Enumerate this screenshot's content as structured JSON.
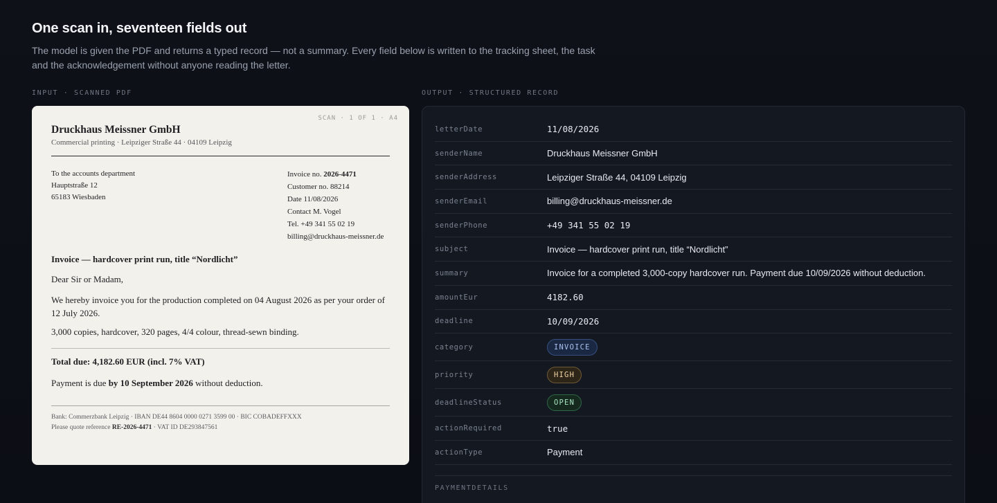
{
  "header": {
    "title": "One scan in, seventeen fields out",
    "intro": "The model is given the PDF and returns a typed record — not a summary. Every field below is written to the tracking sheet, the task and the acknowledgement without anyone reading the letter."
  },
  "input": {
    "section_label": "INPUT · SCANNED PDF",
    "scan_tag": "SCAN · 1 OF 1 · A4",
    "company": "Druckhaus Meissner GmbH",
    "tagline": "Commercial printing · Leipziger Straße 44 · 04109 Leipzig",
    "recipient": [
      "To the accounts department",
      "Hauptstraße 12",
      "65183 Wiesbaden"
    ],
    "meta": {
      "invoice_label": "Invoice no.",
      "invoice_no": "2026-4471",
      "customer": "Customer no. 88214",
      "date": "Date 11/08/2026",
      "contact": "Contact M. Vogel",
      "tel": "Tel. +49 341 55 02 19",
      "email": "billing@druckhaus-meissner.de"
    },
    "subject": "Invoice — hardcover print run, title “Nordlicht”",
    "salutation": "Dear Sir or Madam,",
    "body1": "We hereby invoice you for the production completed on 04 August 2026 as per your order of 12 July 2026.",
    "body2": "3,000 copies, hardcover, 320 pages, 4/4 colour, thread-sewn binding.",
    "total": "Total due: 4,182.60 EUR (incl. 7% VAT)",
    "payment_pre": "Payment is due ",
    "payment_bold": "by 10 September 2026",
    "payment_post": " without deduction.",
    "footer_line1": "Bank: Commerzbank Leipzig · IBAN DE44 8604 0000 0271 3599 00 · BIC COBADEFFXXX",
    "footer_ref_pre": "Please quote reference ",
    "footer_ref": "RE-2026-4471",
    "footer_ref_post": " · VAT ID DE293847561"
  },
  "output": {
    "section_label": "OUTPUT · STRUCTURED RECORD",
    "fields": {
      "letterDate": {
        "key": "letterDate",
        "value": "11/08/2026"
      },
      "senderName": {
        "key": "senderName",
        "value": "Druckhaus Meissner GmbH"
      },
      "senderAddress": {
        "key": "senderAddress",
        "value": "Leipziger Straße 44, 04109 Leipzig"
      },
      "senderEmail": {
        "key": "senderEmail",
        "value": "billing@druckhaus-meissner.de"
      },
      "senderPhone": {
        "key": "senderPhone",
        "value": "+49 341 55 02 19"
      },
      "subject": {
        "key": "subject",
        "value": "Invoice — hardcover print run, title “Nordlicht”"
      },
      "summary": {
        "key": "summary",
        "value": "Invoice for a completed 3,000-copy hardcover run. Payment due 10/09/2026 without deduction."
      },
      "amountEur": {
        "key": "amountEur",
        "value": "4182.60"
      },
      "deadline": {
        "key": "deadline",
        "value": "10/09/2026"
      },
      "category": {
        "key": "category",
        "value": "INVOICE"
      },
      "priority": {
        "key": "priority",
        "value": "HIGH"
      },
      "deadlineStatus": {
        "key": "deadlineStatus",
        "value": "OPEN"
      },
      "actionRequired": {
        "key": "actionRequired",
        "value": "true"
      },
      "actionType": {
        "key": "actionType",
        "value": "Payment"
      }
    },
    "subsection": "PAYMENTDETAILS"
  },
  "colors": {
    "background": "#0d1016",
    "paper": "#f3f1ec",
    "panel": "#141821",
    "pill_invoice": "#35507f",
    "pill_high": "#6f5a37",
    "pill_open": "#2f6647"
  }
}
